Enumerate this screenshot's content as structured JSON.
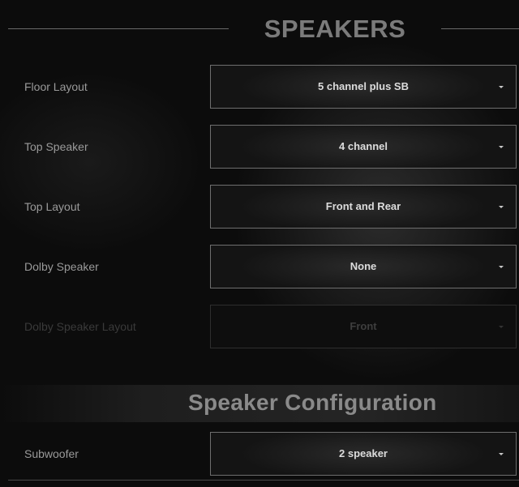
{
  "speakers_section": {
    "title": "SPEAKERS"
  },
  "rows": [
    {
      "label": "Floor Layout",
      "value": "5 channel plus SB",
      "enabled": true
    },
    {
      "label": "Top Speaker",
      "value": "4 channel",
      "enabled": true
    },
    {
      "label": "Top Layout",
      "value": "Front and Rear",
      "enabled": true
    },
    {
      "label": "Dolby Speaker",
      "value": "None",
      "enabled": true
    },
    {
      "label": "Dolby Speaker Layout",
      "value": "Front",
      "enabled": false
    }
  ],
  "config_section": {
    "title": "Speaker Configuration"
  },
  "subwoofer": {
    "label": "Subwoofer",
    "value": "2 speaker",
    "enabled": true
  },
  "icons": {
    "dropdown": "chevron-down-icon"
  }
}
